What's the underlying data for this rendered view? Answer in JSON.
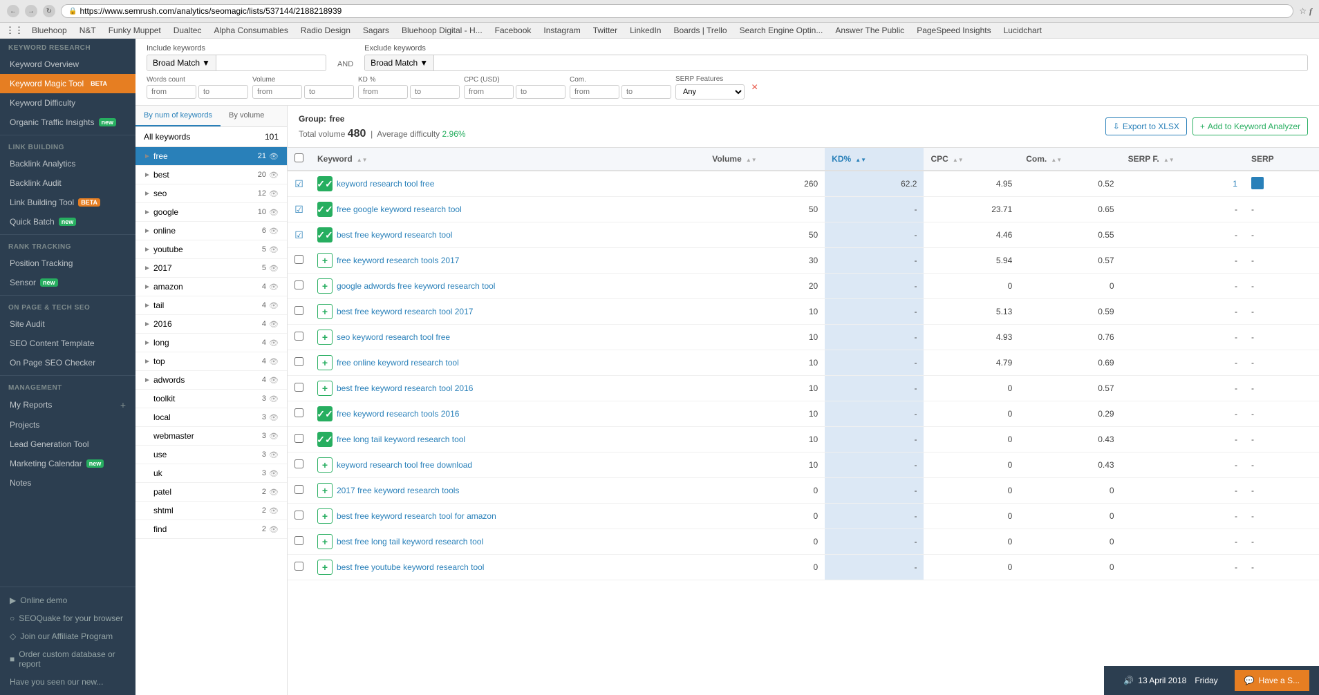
{
  "browser": {
    "url": "https://www.semrush.com/analytics/seomagic/lists/537144/2188218939",
    "secure_label": "Secure"
  },
  "bookmarks": [
    "Apps",
    "Bluehoop",
    "N&T",
    "Funky Muppet",
    "Dualtec",
    "Alpha Consumables",
    "Radio Design",
    "Sagars",
    "Bluehoop Digital - H...",
    "Facebook",
    "Instagram",
    "Twitter",
    "LinkedIn",
    "Boards | Trello",
    "Search Engine Optin...",
    "Answer The Public",
    "PageSpeed Insights",
    "Lucidchart"
  ],
  "sidebar": {
    "keyword_research_header": "KEYWORD RESEARCH",
    "items": [
      {
        "label": "Keyword Overview",
        "badge": null,
        "active": false
      },
      {
        "label": "Keyword Magic Tool",
        "badge": "BETA",
        "badge_type": "beta",
        "active": true
      },
      {
        "label": "Keyword Difficulty",
        "badge": null,
        "active": false
      },
      {
        "label": "Organic Traffic Insights",
        "badge": "NEW",
        "badge_type": "new",
        "active": false
      }
    ],
    "link_building_header": "LINK BUILDING",
    "link_building_items": [
      {
        "label": "Backlink Analytics"
      },
      {
        "label": "Backlink Audit"
      },
      {
        "label": "Link Building Tool",
        "badge": "BETA",
        "badge_type": "beta"
      },
      {
        "label": "Quick Batch",
        "badge": "NEW",
        "badge_type": "new"
      }
    ],
    "rank_tracking_header": "RANK TRACKING",
    "rank_tracking_items": [
      {
        "label": "Position Tracking"
      },
      {
        "label": "Sensor",
        "badge": "NEW",
        "badge_type": "new"
      }
    ],
    "on_page_header": "ON PAGE & TECH SEO",
    "on_page_items": [
      {
        "label": "Site Audit"
      },
      {
        "label": "SEO Content Template"
      },
      {
        "label": "On Page SEO Checker"
      }
    ],
    "management_header": "MANAGEMENT",
    "management_items": [
      {
        "label": "My Reports"
      },
      {
        "label": "Projects"
      },
      {
        "label": "Lead Generation Tool"
      },
      {
        "label": "Marketing Calendar",
        "badge": "NEW",
        "badge_type": "new"
      },
      {
        "label": "Notes"
      }
    ],
    "bottom_items": [
      {
        "label": "Online demo"
      },
      {
        "label": "SEOQuake for your browser"
      },
      {
        "label": "Join our Affiliate Program"
      },
      {
        "label": "Order custom database or report"
      },
      {
        "label": "Have you seen our new..."
      }
    ]
  },
  "filters": {
    "include_label": "Include keywords",
    "exclude_label": "Exclude keywords",
    "include_match": "Broad Match",
    "exclude_match": "Broad Match",
    "and_label": "AND",
    "words_count_label": "Words count",
    "volume_label": "Volume",
    "kd_label": "KD %",
    "cpc_label": "CPC (USD)",
    "com_label": "Com.",
    "serp_label": "SERP Features",
    "from_placeholder": "from",
    "to_placeholder": "to",
    "any_option": "Any"
  },
  "groups_panel": {
    "tab_by_num": "By num of keywords",
    "tab_by_volume": "By volume",
    "all_keywords_label": "All keywords",
    "all_keywords_count": 101,
    "groups": [
      {
        "name": "free",
        "count": 21,
        "active": true
      },
      {
        "name": "best",
        "count": 20,
        "active": false
      },
      {
        "name": "seo",
        "count": 12,
        "active": false
      },
      {
        "name": "google",
        "count": 10,
        "active": false
      },
      {
        "name": "online",
        "count": 6,
        "active": false
      },
      {
        "name": "youtube",
        "count": 5,
        "active": false
      },
      {
        "name": "2017",
        "count": 5,
        "active": false
      },
      {
        "name": "amazon",
        "count": 4,
        "active": false
      },
      {
        "name": "tail",
        "count": 4,
        "active": false
      },
      {
        "name": "2016",
        "count": 4,
        "active": false
      },
      {
        "name": "long",
        "count": 4,
        "active": false
      },
      {
        "name": "top",
        "count": 4,
        "active": false
      },
      {
        "name": "adwords",
        "count": 4,
        "active": false
      },
      {
        "name": "toolkit",
        "count": 3,
        "active": false
      },
      {
        "name": "local",
        "count": 3,
        "active": false
      },
      {
        "name": "webmaster",
        "count": 3,
        "active": false
      },
      {
        "name": "use",
        "count": 3,
        "active": false
      },
      {
        "name": "uk",
        "count": 3,
        "active": false
      },
      {
        "name": "patel",
        "count": 2,
        "active": false
      },
      {
        "name": "shtml",
        "count": 2,
        "active": false
      },
      {
        "name": "find",
        "count": 2,
        "active": false
      }
    ]
  },
  "table": {
    "group_prefix": "Group:",
    "group_name": "free",
    "total_volume_label": "Total volume",
    "total_volume": "480",
    "avg_difficulty_label": "Average difficulty",
    "avg_difficulty": "2.96%",
    "export_label": "Export to XLSX",
    "add_analyzer_label": "Add to Keyword Analyzer",
    "columns": {
      "keyword": "Keyword",
      "volume": "Volume",
      "kd": "KD%",
      "cpc": "CPC",
      "com": "Com.",
      "serp_f": "SERP F.",
      "serp": "SERP"
    },
    "rows": [
      {
        "keyword": "keyword research tool free",
        "volume": 260,
        "kd": 62.2,
        "cpc": 4.95,
        "com": 0.52,
        "serp_f": 1,
        "serp": "icon",
        "checked": true,
        "btn_type": "checked"
      },
      {
        "keyword": "free google keyword research tool",
        "volume": 50,
        "kd": "-",
        "cpc": 23.71,
        "com": 0.65,
        "serp_f": "-",
        "serp": "-",
        "checked": true,
        "btn_type": "checked"
      },
      {
        "keyword": "best free keyword research tool",
        "volume": 50,
        "kd": "-",
        "cpc": 4.46,
        "com": 0.55,
        "serp_f": "-",
        "serp": "-",
        "checked": true,
        "btn_type": "checked"
      },
      {
        "keyword": "free keyword research tools 2017",
        "volume": 30,
        "kd": "-",
        "cpc": 5.94,
        "com": 0.57,
        "serp_f": "-",
        "serp": "-",
        "checked": false,
        "btn_type": "outline"
      },
      {
        "keyword": "google adwords free keyword research tool",
        "volume": 20,
        "kd": "-",
        "cpc": 0,
        "com": 0,
        "serp_f": "-",
        "serp": "-",
        "checked": false,
        "btn_type": "outline"
      },
      {
        "keyword": "best free keyword research tool 2017",
        "volume": 10,
        "kd": "-",
        "cpc": 5.13,
        "com": 0.59,
        "serp_f": "-",
        "serp": "-",
        "checked": false,
        "btn_type": "outline"
      },
      {
        "keyword": "seo keyword research tool free",
        "volume": 10,
        "kd": "-",
        "cpc": 4.93,
        "com": 0.76,
        "serp_f": "-",
        "serp": "-",
        "checked": false,
        "btn_type": "outline"
      },
      {
        "keyword": "free online keyword research tool",
        "volume": 10,
        "kd": "-",
        "cpc": 4.79,
        "com": 0.69,
        "serp_f": "-",
        "serp": "-",
        "checked": false,
        "btn_type": "outline"
      },
      {
        "keyword": "best free keyword research tool 2016",
        "volume": 10,
        "kd": "-",
        "cpc": 0,
        "com": 0.57,
        "serp_f": "-",
        "serp": "-",
        "checked": false,
        "btn_type": "outline"
      },
      {
        "keyword": "free keyword research tools 2016",
        "volume": 10,
        "kd": "-",
        "cpc": 0,
        "com": 0.29,
        "serp_f": "-",
        "serp": "-",
        "checked": false,
        "btn_type": "checked"
      },
      {
        "keyword": "free long tail keyword research tool",
        "volume": 10,
        "kd": "-",
        "cpc": 0,
        "com": 0.43,
        "serp_f": "-",
        "serp": "-",
        "checked": false,
        "btn_type": "checked"
      },
      {
        "keyword": "keyword research tool free download",
        "volume": 10,
        "kd": "-",
        "cpc": 0,
        "com": 0.43,
        "serp_f": "-",
        "serp": "-",
        "checked": false,
        "btn_type": "outline"
      },
      {
        "keyword": "2017 free keyword research tools",
        "volume": 0,
        "kd": "-",
        "cpc": 0,
        "com": 0,
        "serp_f": "-",
        "serp": "-",
        "checked": false,
        "btn_type": "outline"
      },
      {
        "keyword": "best free keyword research tool for amazon",
        "volume": 0,
        "kd": "-",
        "cpc": 0,
        "com": 0,
        "serp_f": "-",
        "serp": "-",
        "checked": false,
        "btn_type": "outline"
      },
      {
        "keyword": "best free long tail keyword research tool",
        "volume": 0,
        "kd": "-",
        "cpc": 0,
        "com": 0,
        "serp_f": "-",
        "serp": "-",
        "checked": false,
        "btn_type": "outline"
      },
      {
        "keyword": "best free youtube keyword research tool",
        "volume": 0,
        "kd": "-",
        "cpc": 0,
        "com": 0,
        "serp_f": "-",
        "serp": "-",
        "checked": false,
        "btn_type": "outline"
      }
    ]
  },
  "bottom_bar": {
    "date": "13 April 2018",
    "day": "Friday",
    "chat_label": "Have a S..."
  }
}
